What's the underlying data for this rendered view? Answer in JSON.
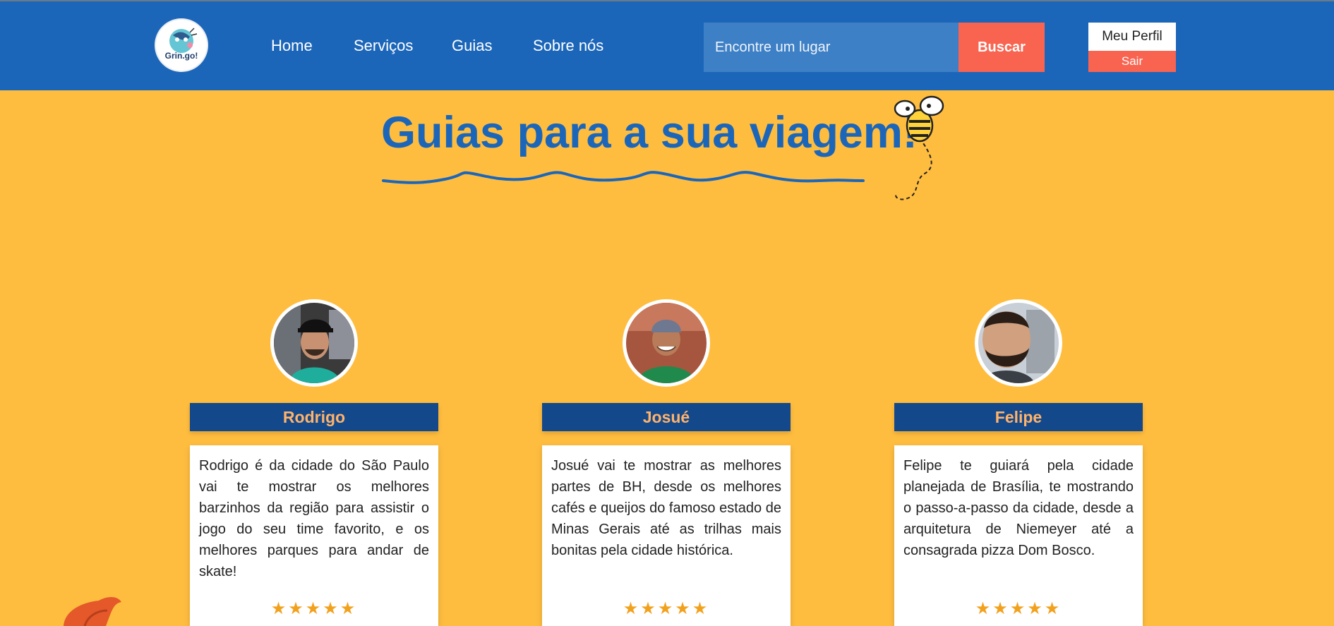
{
  "header": {
    "logo_text": "Grin.go!",
    "nav": [
      "Home",
      "Serviços",
      "Guias",
      "Sobre nós"
    ],
    "search_placeholder": "Encontre um lugar",
    "search_button": "Buscar",
    "profile_label": "Meu Perfil",
    "logout_label": "Sair"
  },
  "main": {
    "title": "Guias para a sua viagem!"
  },
  "guides": [
    {
      "name": "Rodrigo",
      "description": "Rodrigo é da cidade do São Paulo vai te mostrar os melhores barzinhos da região para assistir o jogo do seu time favorito, e os melhores parques para andar de skate!",
      "stars": "★★★★★"
    },
    {
      "name": "Josué",
      "description": "Josué vai te mostrar as melhores partes de BH, desde os melhores cafés e queijos do famoso estado de Minas Gerais até as trilhas mais bonitas pela cidade histórica.",
      "stars": "★★★★★"
    },
    {
      "name": "Felipe",
      "description": "Felipe te guiará pela cidade planejada de Brasília, te mostrando o passo-a-passo da cidade, desde a arquitetura de Niemeyer até a consagrada pizza Dom Bosco.",
      "stars": "★★★★★"
    }
  ],
  "colors": {
    "header_bg": "#1C66BA",
    "page_bg": "#FFBD3F",
    "accent": "#F96450",
    "name_bar": "#13488B",
    "name_text": "#FFB36B",
    "star": "#F2A11D"
  },
  "icons": {
    "logo": "grin-go-logo-icon",
    "bee": "bee-icon",
    "star": "star-icon"
  }
}
